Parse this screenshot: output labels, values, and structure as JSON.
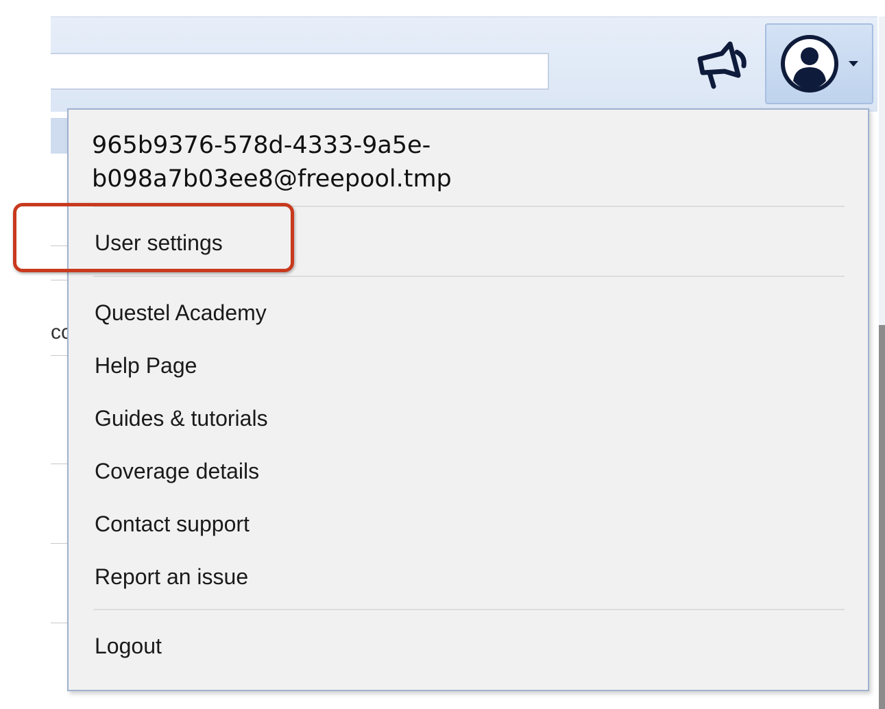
{
  "header": {
    "search_value": "",
    "announce_icon": "megaphone-icon",
    "user_icon": "user-circle-icon",
    "dropdown_caret": "caret-down-icon"
  },
  "background": {
    "cut_text": "cc"
  },
  "user_menu": {
    "email": "965b9376-578d-4333-9a5e-\nb098a7b03ee8@freepool.tmp",
    "user_settings": "User settings",
    "questel_academy": "Questel Academy",
    "help_page": "Help Page",
    "guides_tutorials": "Guides & tutorials",
    "coverage_details": "Coverage details",
    "contact_support": "Contact support",
    "report_issue": "Report an issue",
    "logout": "Logout"
  },
  "annotation": {
    "highlight_color": "#c8391d"
  },
  "colors": {
    "header_bg": "#dbe6f5",
    "menu_bg": "#f1f1f1",
    "menu_border": "#9fb1cf",
    "icon_navy": "#0f1b3a"
  }
}
